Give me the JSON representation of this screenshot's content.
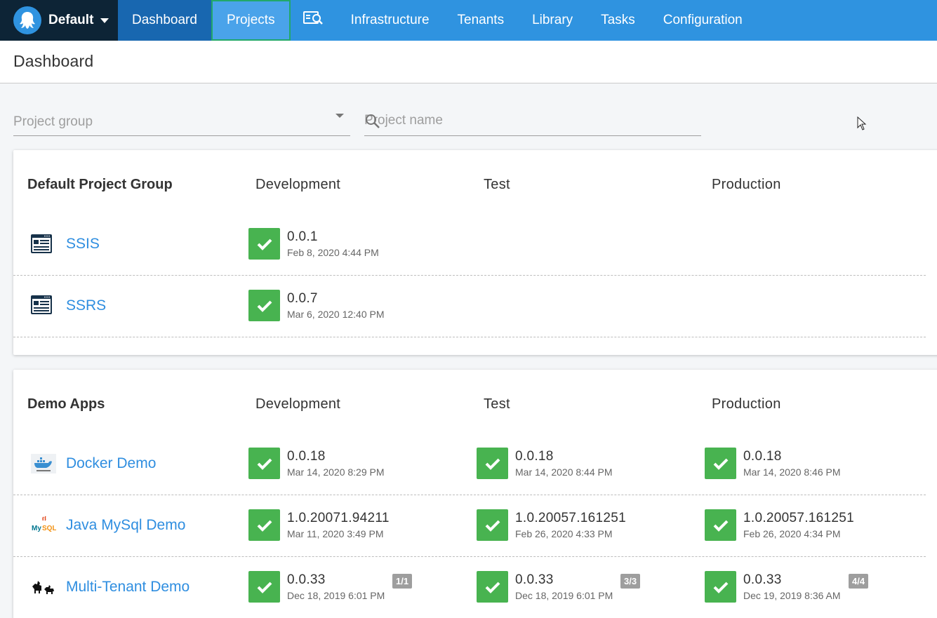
{
  "nav": {
    "space": "Default",
    "items": [
      "Dashboard",
      "Projects",
      "Infrastructure",
      "Tenants",
      "Library",
      "Tasks",
      "Configuration"
    ]
  },
  "header": {
    "title": "Dashboard"
  },
  "filters": {
    "group_placeholder": "Project group",
    "name_placeholder": "Project name"
  },
  "groups": [
    {
      "title": "Default Project Group",
      "environments": [
        "Development",
        "Test",
        "Production"
      ],
      "projects": [
        {
          "name": "SSIS",
          "icon": "window-list-icon",
          "deployments": [
            {
              "version": "0.0.1",
              "date": "Feb 8, 2020 4:44 PM"
            }
          ]
        },
        {
          "name": "SSRS",
          "icon": "window-list-icon",
          "deployments": [
            {
              "version": "0.0.7",
              "date": "Mar 6, 2020 12:40 PM"
            }
          ]
        }
      ]
    },
    {
      "title": "Demo Apps",
      "environments": [
        "Development",
        "Test",
        "Production"
      ],
      "projects": [
        {
          "name": "Docker Demo",
          "icon": "docker-logo-icon",
          "deployments": [
            {
              "version": "0.0.18",
              "date": "Mar 14, 2020 8:29 PM"
            },
            {
              "version": "0.0.18",
              "date": "Mar 14, 2020 8:44 PM"
            },
            {
              "version": "0.0.18",
              "date": "Mar 14, 2020 8:46 PM"
            }
          ]
        },
        {
          "name": "Java MySql Demo",
          "icon": "mysql-logo-icon",
          "deployments": [
            {
              "version": "1.0.20071.94211",
              "date": "Mar 11, 2020 3:49 PM"
            },
            {
              "version": "1.0.20057.161251",
              "date": "Feb 26, 2020 4:33 PM"
            },
            {
              "version": "1.0.20057.161251",
              "date": "Feb 26, 2020 4:34 PM"
            }
          ]
        },
        {
          "name": "Multi-Tenant Demo",
          "icon": "dogs-icon",
          "deployments": [
            {
              "version": "0.0.33",
              "date": "Dec 18, 2019 6:01 PM",
              "tenants": "1/1"
            },
            {
              "version": "0.0.33",
              "date": "Dec 18, 2019 6:01 PM",
              "tenants": "3/3"
            },
            {
              "version": "0.0.33",
              "date": "Dec 19, 2019 8:36 AM",
              "tenants": "4/4"
            }
          ]
        }
      ]
    }
  ],
  "colors": {
    "nav": "#2f93e0",
    "nav_active": "#1867b0",
    "space_bg": "#0d2436",
    "success": "#48b350",
    "link": "#2f8ee0"
  }
}
